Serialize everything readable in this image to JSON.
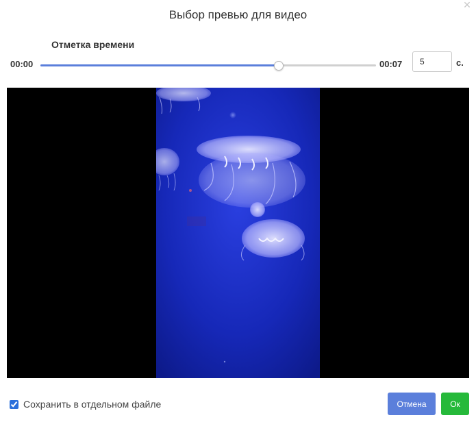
{
  "dialog": {
    "title": "Выбор превью для видео",
    "close_icon": "close-icon"
  },
  "timestamp": {
    "label": "Отметка времени",
    "start": "00:00",
    "end": "00:07",
    "slider_fraction": 0.71,
    "value": "5",
    "unit": "с."
  },
  "video": {
    "content": "jellyfish-aquarium-frame",
    "background": "#000000"
  },
  "options": {
    "save_separate_label": "Сохранить в отдельном файле",
    "save_separate_checked": true
  },
  "buttons": {
    "cancel": "Отмена",
    "ok": "Ок"
  },
  "colors": {
    "accent": "#5b7fdb",
    "ok": "#26b93a"
  }
}
